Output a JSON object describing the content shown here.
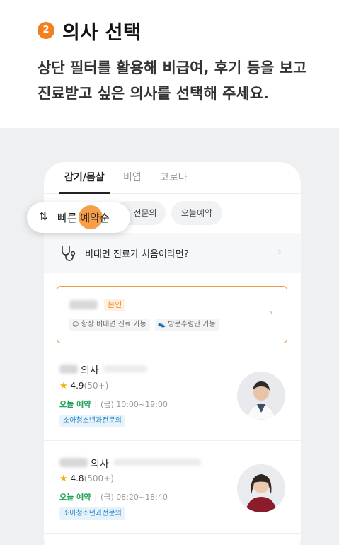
{
  "step": {
    "number": "2",
    "title": "의사 선택"
  },
  "description": {
    "line1": "상단 필터를 활용해 비급여, 후기 등을 보고",
    "line2": "진료받고 싶은 의사를 선택해 주세요."
  },
  "tabs": [
    {
      "label": "감기/몸살",
      "active": true
    },
    {
      "label": "비염",
      "active": false
    },
    {
      "label": "코로나",
      "active": false
    }
  ],
  "filters": [
    {
      "label": "전문의"
    },
    {
      "label": "오늘예약"
    }
  ],
  "sort": {
    "label": "빠른 예약순",
    "icon": "sort-arrows-icon"
  },
  "banner": {
    "text": "비대면 진료가 처음이라면?",
    "icon": "stethoscope-icon"
  },
  "self_card": {
    "badge": "본인",
    "features": [
      {
        "icon": "smile-icon",
        "label": "항상 비대면 진료 가능"
      },
      {
        "icon": "shoe-icon",
        "label": "방문수령만 가능"
      }
    ]
  },
  "doctors": [
    {
      "suffix": "의사",
      "rating": "4.9",
      "reviews": "(50+)",
      "status": "오늘 예약",
      "hours": "(금) 10:00~19:00",
      "specialty": "소아청소년과전문의"
    },
    {
      "suffix": "의사",
      "rating": "4.8",
      "reviews": "(500+)",
      "status": "오늘 예약",
      "hours": "(금) 08:20~18:40",
      "specialty": "소아청소년과전문의"
    }
  ],
  "colors": {
    "accent": "#f47f1f",
    "open_status": "#21a35a",
    "specialty_text": "#2a84c8",
    "star": "#f5b10a"
  }
}
